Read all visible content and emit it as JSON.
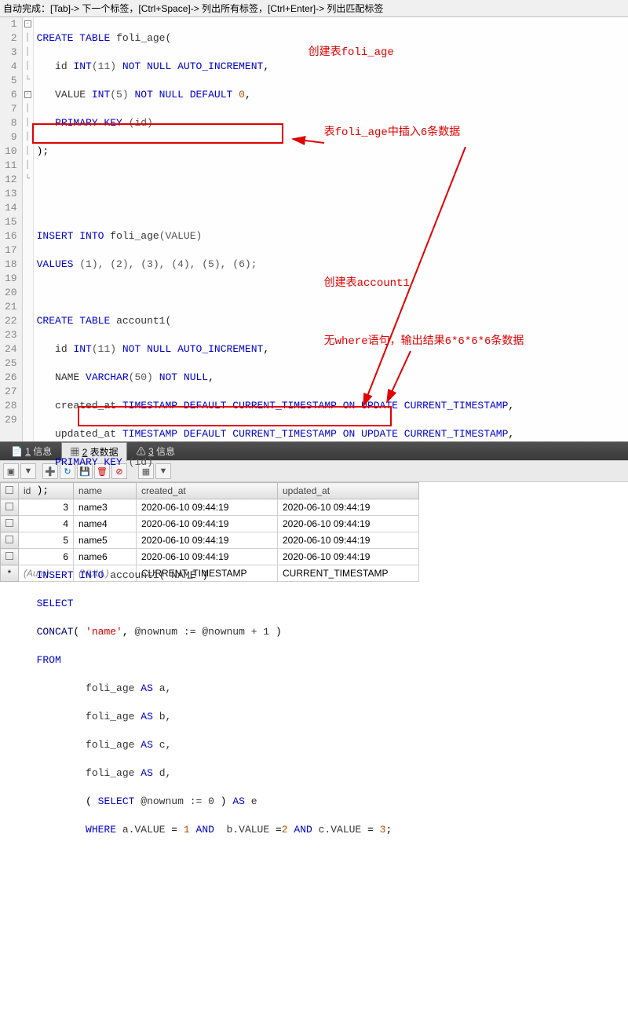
{
  "hintbar": "自动完成：[Tab]-> 下一个标签，[Ctrl+Space]-> 列出所有标签，[Ctrl+Enter]-> 列出匹配标签",
  "annotations": {
    "a1": "创建表foli_age",
    "a2": "表foli_age中插入6条数据",
    "a3": "创建表account1",
    "a4": "无where语句，输出结果6*6*6*6条数据"
  },
  "code": {
    "l1": {
      "kw1": "CREATE",
      "kw2": "TABLE",
      "ident": "foli_age("
    },
    "l2": {
      "ident": "id",
      "type": "INT",
      "arg": "(11)",
      "nn": "NOT NULL",
      "ai": "AUTO_INCREMENT",
      "comma": ","
    },
    "l3": {
      "ident": "VALUE",
      "type": "INT",
      "arg": "(5)",
      "nn": "NOT NULL",
      "df": "DEFAULT",
      "zero": "0",
      "comma": ","
    },
    "l4": {
      "pk": "PRIMARY KEY",
      "arg": "(id)"
    },
    "l5": {
      "t": ");"
    },
    "l8": {
      "kw1": "INSERT",
      "kw2": "INTO",
      "ident": "foli_age",
      "arg": "(VALUE)"
    },
    "l9": {
      "kw": "VALUES",
      "vals": "(1), (2), (3), (4), (5), (6);"
    },
    "l11": {
      "kw1": "CREATE",
      "kw2": "TABLE",
      "ident": "account1("
    },
    "l12": {
      "ident": "id",
      "type": "INT",
      "arg": "(11)",
      "nn": "NOT NULL",
      "ai": "AUTO_INCREMENT",
      "comma": ","
    },
    "l13": {
      "ident": "NAME",
      "type": "VARCHAR",
      "arg": "(50)",
      "nn": "NOT NULL",
      "comma": ","
    },
    "l14": {
      "ident": "created_at",
      "type": "TIMESTAMP",
      "df": "DEFAULT",
      "ct": "CURRENT_TIMESTAMP",
      "on": "ON",
      "upd": "UPDATE",
      "ct2": "CURRENT_TIMESTAMP",
      "comma": ","
    },
    "l15": {
      "ident": "updated_at",
      "type": "TIMESTAMP",
      "df": "DEFAULT",
      "ct": "CURRENT_TIMESTAMP",
      "on": "ON",
      "upd": "UPDATE",
      "ct2": "CURRENT_TIMESTAMP",
      "comma": ","
    },
    "l16": {
      "pk": "PRIMARY KEY",
      "arg": "(id)"
    },
    "l17": {
      "t": ");"
    },
    "l20": {
      "kw1": "INSERT",
      "kw2": "INTO",
      "ident": "account1(",
      "col": "NAME",
      "close": ")"
    },
    "l21": {
      "kw": "SELECT"
    },
    "l22": {
      "fn": "CONCAT",
      "p1": "(",
      "str": "'name'",
      "c1": ",",
      "var": "@nownum := @nownum + 1",
      "p2": ")"
    },
    "l23": {
      "kw": "FROM"
    },
    "l24": {
      "ident": "foli_age",
      "as": "AS",
      "a": "a,"
    },
    "l25": {
      "ident": "foli_age",
      "as": "AS",
      "a": "b,"
    },
    "l26": {
      "ident": "foli_age",
      "as": "AS",
      "a": "c,"
    },
    "l27": {
      "ident": "foli_age",
      "as": "AS",
      "a": "d,"
    },
    "l28": {
      "p1": "(",
      "kw": "SELECT",
      "var": "@nownum := 0",
      "p2": ")",
      "as": "AS",
      "a": "e"
    },
    "l29": {
      "kw": "WHERE",
      "a": "a.VALUE",
      "eq1": "=",
      "v1": "1",
      "and1": "AND",
      "b": "b.VALUE",
      "eq2": "=",
      "v2": "2",
      "and2": "AND",
      "c": "c.VALUE",
      "eq3": "=",
      "v3": "3",
      "semi": ";"
    }
  },
  "tabs": {
    "t1_u": "1",
    "t1": " 信息",
    "t2_u": "2",
    "t2": " 表数据",
    "t3_u": "3",
    "t3": " 信息"
  },
  "grid": {
    "headers": {
      "id": "id",
      "name": "name",
      "created_at": "created_at",
      "updated_at": "updated_at"
    },
    "rows": [
      {
        "id": "3",
        "name": "name3",
        "created_at": "2020-06-10 09:44:19",
        "updated_at": "2020-06-10 09:44:19"
      },
      {
        "id": "4",
        "name": "name4",
        "created_at": "2020-06-10 09:44:19",
        "updated_at": "2020-06-10 09:44:19"
      },
      {
        "id": "5",
        "name": "name5",
        "created_at": "2020-06-10 09:44:19",
        "updated_at": "2020-06-10 09:44:19"
      },
      {
        "id": "6",
        "name": "name6",
        "created_at": "2020-06-10 09:44:19",
        "updated_at": "2020-06-10 09:44:19"
      }
    ],
    "newrow": {
      "id": "(Auto)",
      "name": "(NULL)",
      "created_at": "CURRENT_TIMESTAMP",
      "updated_at": "CURRENT_TIMESTAMP"
    }
  }
}
